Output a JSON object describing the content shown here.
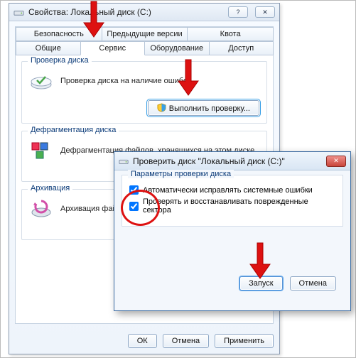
{
  "props": {
    "title": "Свойства: Локальный диск (C:)",
    "tabs_row1": [
      "Безопасность",
      "Предыдущие версии",
      "Квота"
    ],
    "tabs_row2": [
      "Общие",
      "Сервис",
      "Оборудование",
      "Доступ"
    ],
    "active_tab": "Сервис",
    "check": {
      "group": "Проверка диска",
      "desc": "Проверка диска на наличие ошибок.",
      "button": "Выполнить проверку..."
    },
    "defrag": {
      "group": "Дефрагментация диска",
      "desc": "Дефрагментация файлов, хранящихся на этом диске."
    },
    "backup": {
      "group": "Архивация",
      "desc": "Архивация файлов, хранящихся на этом диске."
    },
    "buttons": {
      "ok": "ОК",
      "cancel": "Отмена",
      "apply": "Применить"
    }
  },
  "chkdlg": {
    "title": "Проверить диск \"Локальный диск (C:)\"",
    "group": "Параметры проверки диска",
    "opt1": "Автоматически исправлять системные ошибки",
    "opt2": "Проверять и восстанавливать поврежденные сектора",
    "opt1_checked": true,
    "opt2_checked": true,
    "start": "Запуск",
    "cancel": "Отмена"
  },
  "icons": {
    "drive": "drive-icon",
    "defrag": "defrag-icon",
    "backup": "backup-icon",
    "shield": "shield-icon"
  }
}
